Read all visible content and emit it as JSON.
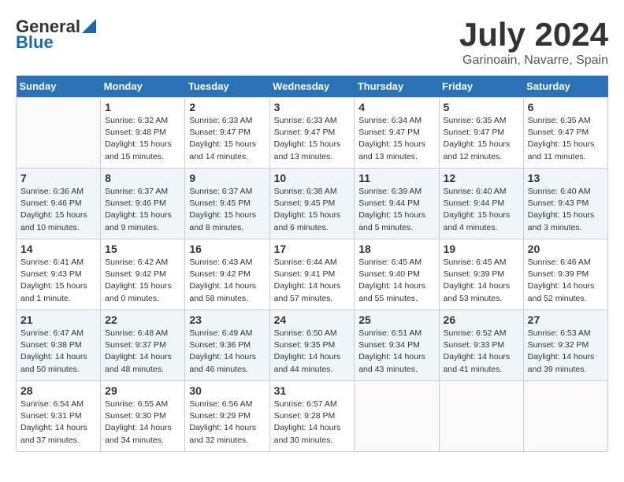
{
  "header": {
    "logo_general": "General",
    "logo_blue": "Blue",
    "title": "July 2024",
    "location": "Garinoain, Navarre, Spain"
  },
  "days_of_week": [
    "Sunday",
    "Monday",
    "Tuesday",
    "Wednesday",
    "Thursday",
    "Friday",
    "Saturday"
  ],
  "weeks": [
    [
      {
        "day": "",
        "info": ""
      },
      {
        "day": "1",
        "info": "Sunrise: 6:32 AM\nSunset: 9:48 PM\nDaylight: 15 hours\nand 15 minutes."
      },
      {
        "day": "2",
        "info": "Sunrise: 6:33 AM\nSunset: 9:47 PM\nDaylight: 15 hours\nand 14 minutes."
      },
      {
        "day": "3",
        "info": "Sunrise: 6:33 AM\nSunset: 9:47 PM\nDaylight: 15 hours\nand 13 minutes."
      },
      {
        "day": "4",
        "info": "Sunrise: 6:34 AM\nSunset: 9:47 PM\nDaylight: 15 hours\nand 13 minutes."
      },
      {
        "day": "5",
        "info": "Sunrise: 6:35 AM\nSunset: 9:47 PM\nDaylight: 15 hours\nand 12 minutes."
      },
      {
        "day": "6",
        "info": "Sunrise: 6:35 AM\nSunset: 9:47 PM\nDaylight: 15 hours\nand 11 minutes."
      }
    ],
    [
      {
        "day": "7",
        "info": "Sunrise: 6:36 AM\nSunset: 9:46 PM\nDaylight: 15 hours\nand 10 minutes."
      },
      {
        "day": "8",
        "info": "Sunrise: 6:37 AM\nSunset: 9:46 PM\nDaylight: 15 hours\nand 9 minutes."
      },
      {
        "day": "9",
        "info": "Sunrise: 6:37 AM\nSunset: 9:45 PM\nDaylight: 15 hours\nand 8 minutes."
      },
      {
        "day": "10",
        "info": "Sunrise: 6:38 AM\nSunset: 9:45 PM\nDaylight: 15 hours\nand 6 minutes."
      },
      {
        "day": "11",
        "info": "Sunrise: 6:39 AM\nSunset: 9:44 PM\nDaylight: 15 hours\nand 5 minutes."
      },
      {
        "day": "12",
        "info": "Sunrise: 6:40 AM\nSunset: 9:44 PM\nDaylight: 15 hours\nand 4 minutes."
      },
      {
        "day": "13",
        "info": "Sunrise: 6:40 AM\nSunset: 9:43 PM\nDaylight: 15 hours\nand 3 minutes."
      }
    ],
    [
      {
        "day": "14",
        "info": "Sunrise: 6:41 AM\nSunset: 9:43 PM\nDaylight: 15 hours\nand 1 minute."
      },
      {
        "day": "15",
        "info": "Sunrise: 6:42 AM\nSunset: 9:42 PM\nDaylight: 15 hours\nand 0 minutes."
      },
      {
        "day": "16",
        "info": "Sunrise: 6:43 AM\nSunset: 9:42 PM\nDaylight: 14 hours\nand 58 minutes."
      },
      {
        "day": "17",
        "info": "Sunrise: 6:44 AM\nSunset: 9:41 PM\nDaylight: 14 hours\nand 57 minutes."
      },
      {
        "day": "18",
        "info": "Sunrise: 6:45 AM\nSunset: 9:40 PM\nDaylight: 14 hours\nand 55 minutes."
      },
      {
        "day": "19",
        "info": "Sunrise: 6:45 AM\nSunset: 9:39 PM\nDaylight: 14 hours\nand 53 minutes."
      },
      {
        "day": "20",
        "info": "Sunrise: 6:46 AM\nSunset: 9:39 PM\nDaylight: 14 hours\nand 52 minutes."
      }
    ],
    [
      {
        "day": "21",
        "info": "Sunrise: 6:47 AM\nSunset: 9:38 PM\nDaylight: 14 hours\nand 50 minutes."
      },
      {
        "day": "22",
        "info": "Sunrise: 6:48 AM\nSunset: 9:37 PM\nDaylight: 14 hours\nand 48 minutes."
      },
      {
        "day": "23",
        "info": "Sunrise: 6:49 AM\nSunset: 9:36 PM\nDaylight: 14 hours\nand 46 minutes."
      },
      {
        "day": "24",
        "info": "Sunrise: 6:50 AM\nSunset: 9:35 PM\nDaylight: 14 hours\nand 44 minutes."
      },
      {
        "day": "25",
        "info": "Sunrise: 6:51 AM\nSunset: 9:34 PM\nDaylight: 14 hours\nand 43 minutes."
      },
      {
        "day": "26",
        "info": "Sunrise: 6:52 AM\nSunset: 9:33 PM\nDaylight: 14 hours\nand 41 minutes."
      },
      {
        "day": "27",
        "info": "Sunrise: 6:53 AM\nSunset: 9:32 PM\nDaylight: 14 hours\nand 39 minutes."
      }
    ],
    [
      {
        "day": "28",
        "info": "Sunrise: 6:54 AM\nSunset: 9:31 PM\nDaylight: 14 hours\nand 37 minutes."
      },
      {
        "day": "29",
        "info": "Sunrise: 6:55 AM\nSunset: 9:30 PM\nDaylight: 14 hours\nand 34 minutes."
      },
      {
        "day": "30",
        "info": "Sunrise: 6:56 AM\nSunset: 9:29 PM\nDaylight: 14 hours\nand 32 minutes."
      },
      {
        "day": "31",
        "info": "Sunrise: 6:57 AM\nSunset: 9:28 PM\nDaylight: 14 hours\nand 30 minutes."
      },
      {
        "day": "",
        "info": ""
      },
      {
        "day": "",
        "info": ""
      },
      {
        "day": "",
        "info": ""
      }
    ]
  ]
}
